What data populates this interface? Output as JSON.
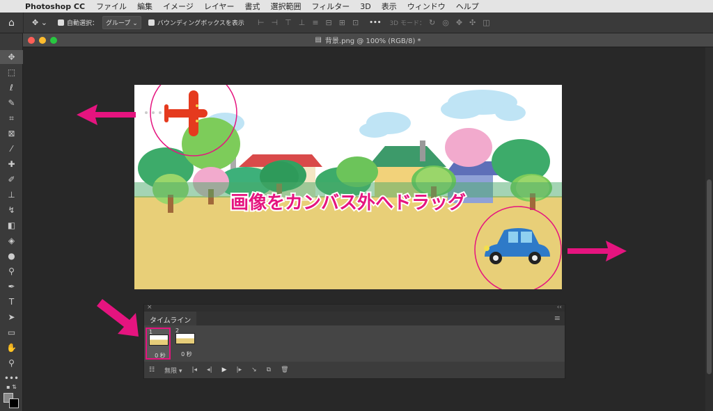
{
  "menubar": {
    "apple": "",
    "app": "Photoshop CC",
    "items": [
      "ファイル",
      "編集",
      "イメージ",
      "レイヤー",
      "書式",
      "選択範囲",
      "フィルター",
      "3D",
      "表示",
      "ウィンドウ",
      "ヘルプ"
    ]
  },
  "options": {
    "auto_select": "自動選択：",
    "group": "グループ",
    "bbox": "バウンディングボックスを表示",
    "more": "•••",
    "mode3d": "3D モード："
  },
  "document": {
    "title": "背景.png @ 100% (RGB/8) *"
  },
  "canvas": {
    "caption": "画像をカンバス外へドラッグ"
  },
  "timeline": {
    "tab": "タイムライン",
    "frames": [
      {
        "num": "1",
        "dur": "0 秒"
      },
      {
        "num": "2",
        "dur": "0 秒"
      }
    ],
    "loop": "無限"
  },
  "colors": {
    "accent": "#e5147f",
    "sky": "#bfe4f5",
    "ground": "#e8cf78"
  }
}
